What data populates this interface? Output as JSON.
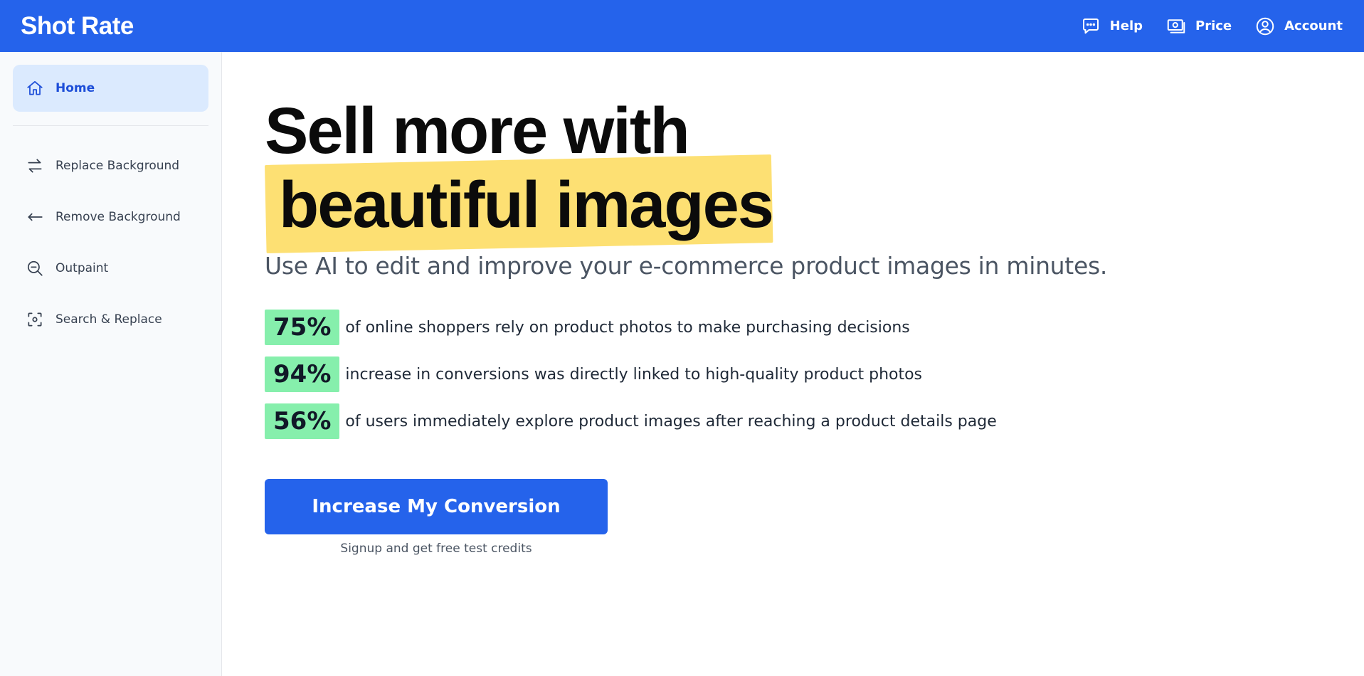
{
  "header": {
    "brand": "Shot Rate",
    "nav": [
      {
        "label": "Help",
        "icon": "chat-bubble-icon"
      },
      {
        "label": "Price",
        "icon": "banknote-icon"
      },
      {
        "label": "Account",
        "icon": "user-circle-icon"
      }
    ],
    "background_color": "#2563eb"
  },
  "sidebar": {
    "home": {
      "label": "Home",
      "icon": "home-icon",
      "active": true
    },
    "items": [
      {
        "label": "Replace Background",
        "icon": "swap-arrows-icon"
      },
      {
        "label": "Remove Background",
        "icon": "arrow-left-icon"
      },
      {
        "label": "Outpaint",
        "icon": "zoom-out-icon"
      },
      {
        "label": "Search & Replace",
        "icon": "scan-target-icon"
      }
    ]
  },
  "main": {
    "headline_line1": "Sell more with",
    "headline_line2": "beautiful images",
    "highlight_color": "#fde073",
    "subhead": "Use AI to edit and improve your e-commerce product images in minutes.",
    "stats": [
      {
        "value": "75%",
        "text": "of online shoppers rely on product photos to make purchasing decisions"
      },
      {
        "value": "94%",
        "text": "increase in conversions was directly linked to high-quality product photos"
      },
      {
        "value": "56%",
        "text": "of users immediately explore product images after reaching a product details page"
      }
    ],
    "stat_badge_color": "#86efac",
    "cta_label": "Increase My Conversion",
    "cta_note": "Signup and get free test credits"
  }
}
